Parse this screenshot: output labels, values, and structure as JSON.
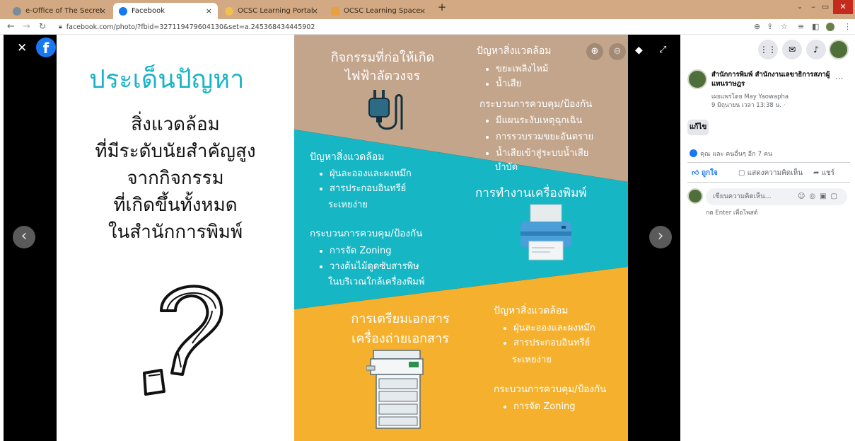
{
  "browser": {
    "tabs": [
      {
        "label": "e-Office of The Secretariat of Th",
        "close": "×"
      },
      {
        "label": "Facebook",
        "close": "×"
      },
      {
        "label": "OCSC Learning Portal",
        "close": "×"
      },
      {
        "label": "OCSC Learning Space",
        "close": "×"
      }
    ],
    "new_tab": "+",
    "url": "facebook.com/photo/?fbid=327119479604130&set=a.245368434445902",
    "window_controls": {
      "minimize": "–",
      "maximize": "▭",
      "close": "✕"
    }
  },
  "viewer": {
    "close": "✕",
    "fb_logo": "f",
    "prev": "‹",
    "next": "›"
  },
  "infographic": {
    "left": {
      "heading": "ประเด็นปัญหา",
      "lines": [
        "สิ่งแวดล้อม",
        "ที่มีระดับนัยสำคัญสูง",
        "จากกิจกรรม",
        "ที่เกิดขึ้นทั้งหมด",
        "ในสำนักการพิมพ์"
      ]
    },
    "section1": {
      "title_lines": [
        "กิจกรรมที่ก่อให้เกิด",
        "ไฟฟ้าลัดวงจร"
      ],
      "problem_heading": "ปัญหาสิ่งแวดล้อม",
      "problems": [
        "ขยะเพลิงไหม้",
        "น้ำเสีย"
      ],
      "control_heading": "กระบวนการควบคุม/ป้องกัน",
      "controls": [
        "มีแผนระงับเหตุฉุกเฉิน",
        "การรวบรวมขยะอันตราย",
        "น้ำเสียเข้าสู่ระบบน้ำเสีย"
      ],
      "control_tail": "บำบัด"
    },
    "section2": {
      "title": "การทำงานเครื่องพิมพ์",
      "problem_heading": "ปัญหาสิ่งแวดล้อม",
      "problems": [
        "ฝุ่นละอองและผงหมึก",
        "สารประกอบอินทรีย์"
      ],
      "problem_tail": "ระเหยง่าย",
      "control_heading": "กระบวนการควบคุม/ป้องกัน",
      "controls": [
        "การจัด Zoning",
        "วางต้นไม้ดูดซับสารพิษ"
      ],
      "control_tail": "ในบริเวณใกล้เครื่องพิมพ์"
    },
    "section3": {
      "title_lines": [
        "การเตรียมเอกสาร",
        "เครื่องถ่ายเอกสาร"
      ],
      "problem_heading": "ปัญหาสิ่งแวดล้อม",
      "problems": [
        "ฝุ่นละอองและผงหมึก",
        "สารประกอบอินทรีย์"
      ],
      "problem_tail": "ระเหยง่าย",
      "control_heading": "กระบวนการควบคุม/ป้องกัน",
      "controls": [
        "การจัด Zoning"
      ]
    },
    "colors": {
      "tan": "#c3a58c",
      "teal": "#16b6c4",
      "yellow": "#f5b12d",
      "heading_teal": "#1ab4c5"
    }
  },
  "sidebar": {
    "page_name": "สำนักการพิมพ์ สำนักงานเลขาธิการสภาผู้แทนราษฎร",
    "posted_by": "เผยแพร่โดย May Yaowapha",
    "date": "9 มิถุนายน เวลา 13:38 น. ·",
    "edit_button": "แก้ไข",
    "reactions": "คุณ และ คนอื่นๆ อีก 7 คน",
    "like": "ถูกใจ",
    "comment": "แสดงความคิดเห็น",
    "share": "แชร์",
    "comment_placeholder": "เขียนความคิดเห็น...",
    "enter_hint": "กด Enter เพื่อโพสต์",
    "more": "···"
  }
}
